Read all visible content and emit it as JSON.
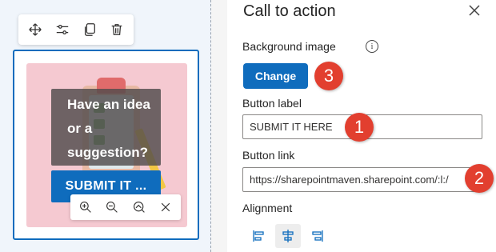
{
  "toolbar": {
    "icons": [
      "move-icon",
      "edit-properties-icon",
      "duplicate-icon",
      "delete-icon"
    ]
  },
  "cta": {
    "text_lines": [
      "Have an idea",
      "or a",
      "suggestion?"
    ],
    "button_label": "SUBMIT IT ..."
  },
  "image_toolbar": {
    "icons": [
      "zoom-in-icon",
      "zoom-out-icon",
      "reset-zoom-icon",
      "close-icon"
    ]
  },
  "pane": {
    "title": "Call to action",
    "background_image_label": "Background image",
    "change_button": "Change",
    "button_label_label": "Button label",
    "button_label_value": "SUBMIT IT HERE",
    "button_link_label": "Button link",
    "button_link_value": "https://sharepointmaven.sharepoint.com/:l:/",
    "alignment_label": "Alignment",
    "alignment_options": [
      "align-left",
      "align-center",
      "align-right"
    ],
    "alignment_selected": "align-center"
  },
  "badges": {
    "one": "1",
    "two": "2",
    "three": "3"
  },
  "colors": {
    "accent": "#0f6cbd",
    "badge": "#e23f2f",
    "image_bg": "#f5c9d1"
  }
}
